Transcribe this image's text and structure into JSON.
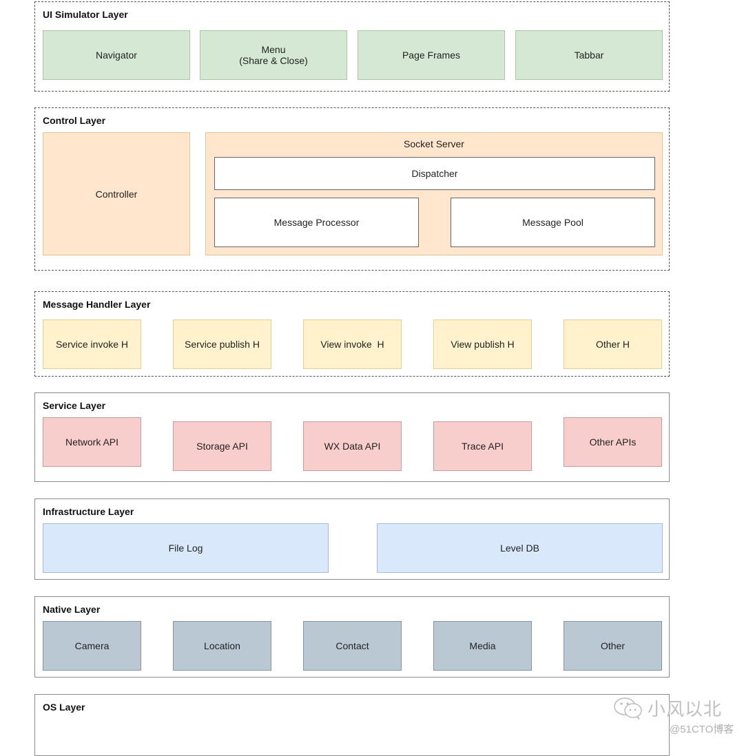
{
  "layers": {
    "ui_simulator": {
      "title": "UI Simulator Layer",
      "items": [
        "Navigator",
        "Menu\n(Share & Close)",
        "Page Frames",
        "Tabbar"
      ],
      "color": "#d5e8d4"
    },
    "control": {
      "title": "Control Layer",
      "controller": "Controller",
      "socket_server": {
        "title": "Socket Server",
        "dispatcher": "Dispatcher",
        "message_processor": "Message Processor",
        "message_pool": "Message Pool"
      },
      "color": "#ffe6cc"
    },
    "message_handler": {
      "title": "Message Handler Layer",
      "items": [
        "Service invoke H",
        "Service publish H",
        "View invoke  H",
        "View publish H",
        "Other H"
      ],
      "color": "#fff2cc"
    },
    "service": {
      "title": "Service Layer",
      "items": [
        "Network API",
        "Storage API",
        "WX Data API",
        "Trace API",
        "Other APIs"
      ],
      "color": "#f8cecc"
    },
    "infrastructure": {
      "title": "Infrastructure Layer",
      "items": [
        "File Log",
        "Level DB"
      ],
      "color": "#dae8fc"
    },
    "native": {
      "title": "Native Layer",
      "items": [
        "Camera",
        "Location",
        "Contact",
        "Media",
        "Other"
      ],
      "color": "#bac8d3"
    },
    "os": {
      "title": "OS Layer"
    }
  },
  "watermark": {
    "icon": "wechat-icon",
    "main": "小风以北",
    "sub": "@51CTO博客"
  }
}
